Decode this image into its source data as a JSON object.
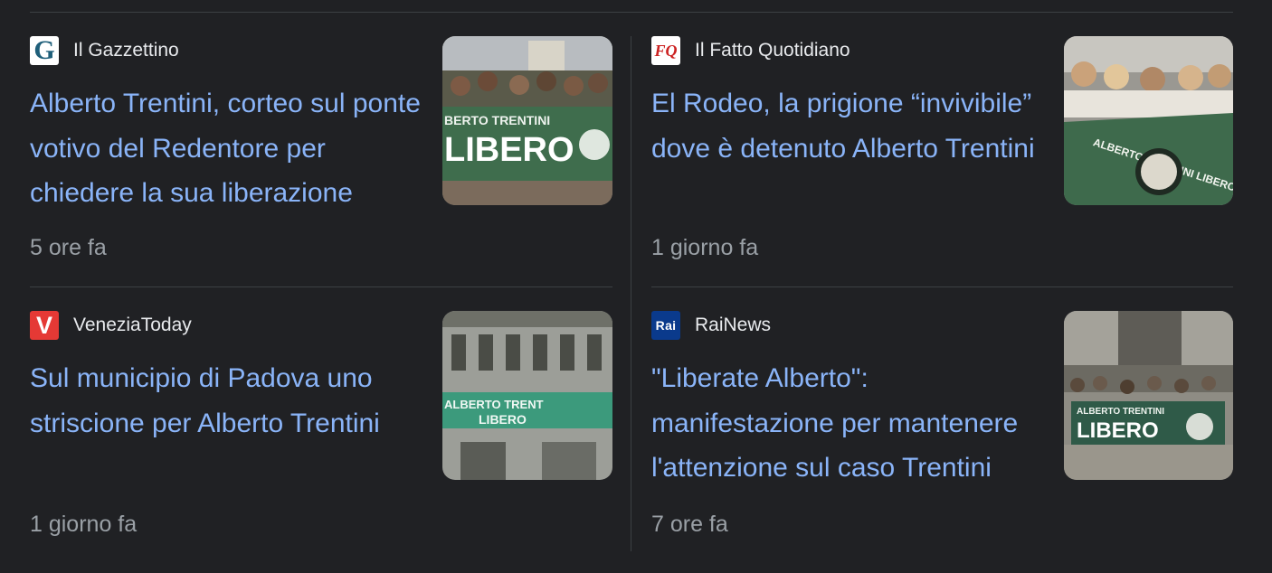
{
  "articles": [
    {
      "source": "Il Gazzettino",
      "logo_text": "G",
      "logo_icon": "gazzettino-logo-icon",
      "title": "Alberto Trentini, corteo sul ponte votivo del Redentore per chiedere la sua liberazione",
      "time": "5 ore fa",
      "banner_text": [
        "BERTO TRENTINI",
        "LIBERO"
      ]
    },
    {
      "source": "Il Fatto Quotidiano",
      "logo_text": "FQ",
      "logo_icon": "fatto-quotidiano-logo-icon",
      "title": "El Rodeo, la prigione “invivibile” dove è detenuto Alberto Trentini",
      "time": "1 giorno fa",
      "banner_text": [
        "ALBERTO TRENTINI LIBERO"
      ]
    },
    {
      "source": "VeneziaToday",
      "logo_text": "V",
      "logo_icon": "venezia-today-logo-icon",
      "title": "Sul municipio di Padova uno striscione per Alberto Trentini",
      "time": "1 giorno fa",
      "banner_text": [
        "ALBERTO TRENT",
        "LIBERO"
      ]
    },
    {
      "source": "RaiNews",
      "logo_text": "Rai",
      "logo_icon": "rai-news-logo-icon",
      "title": "\"Liberate Alberto\": manifestazione per mantenere l'attenzione sul caso Trentini",
      "time": "7 ore fa",
      "banner_text": [
        "ALBERTO TRENTINI",
        "LIBERO"
      ]
    }
  ],
  "colors": {
    "background": "#202124",
    "title": "#8ab4f8",
    "source": "#e8eaed",
    "time": "#9aa0a6",
    "divider": "#3c4043"
  }
}
